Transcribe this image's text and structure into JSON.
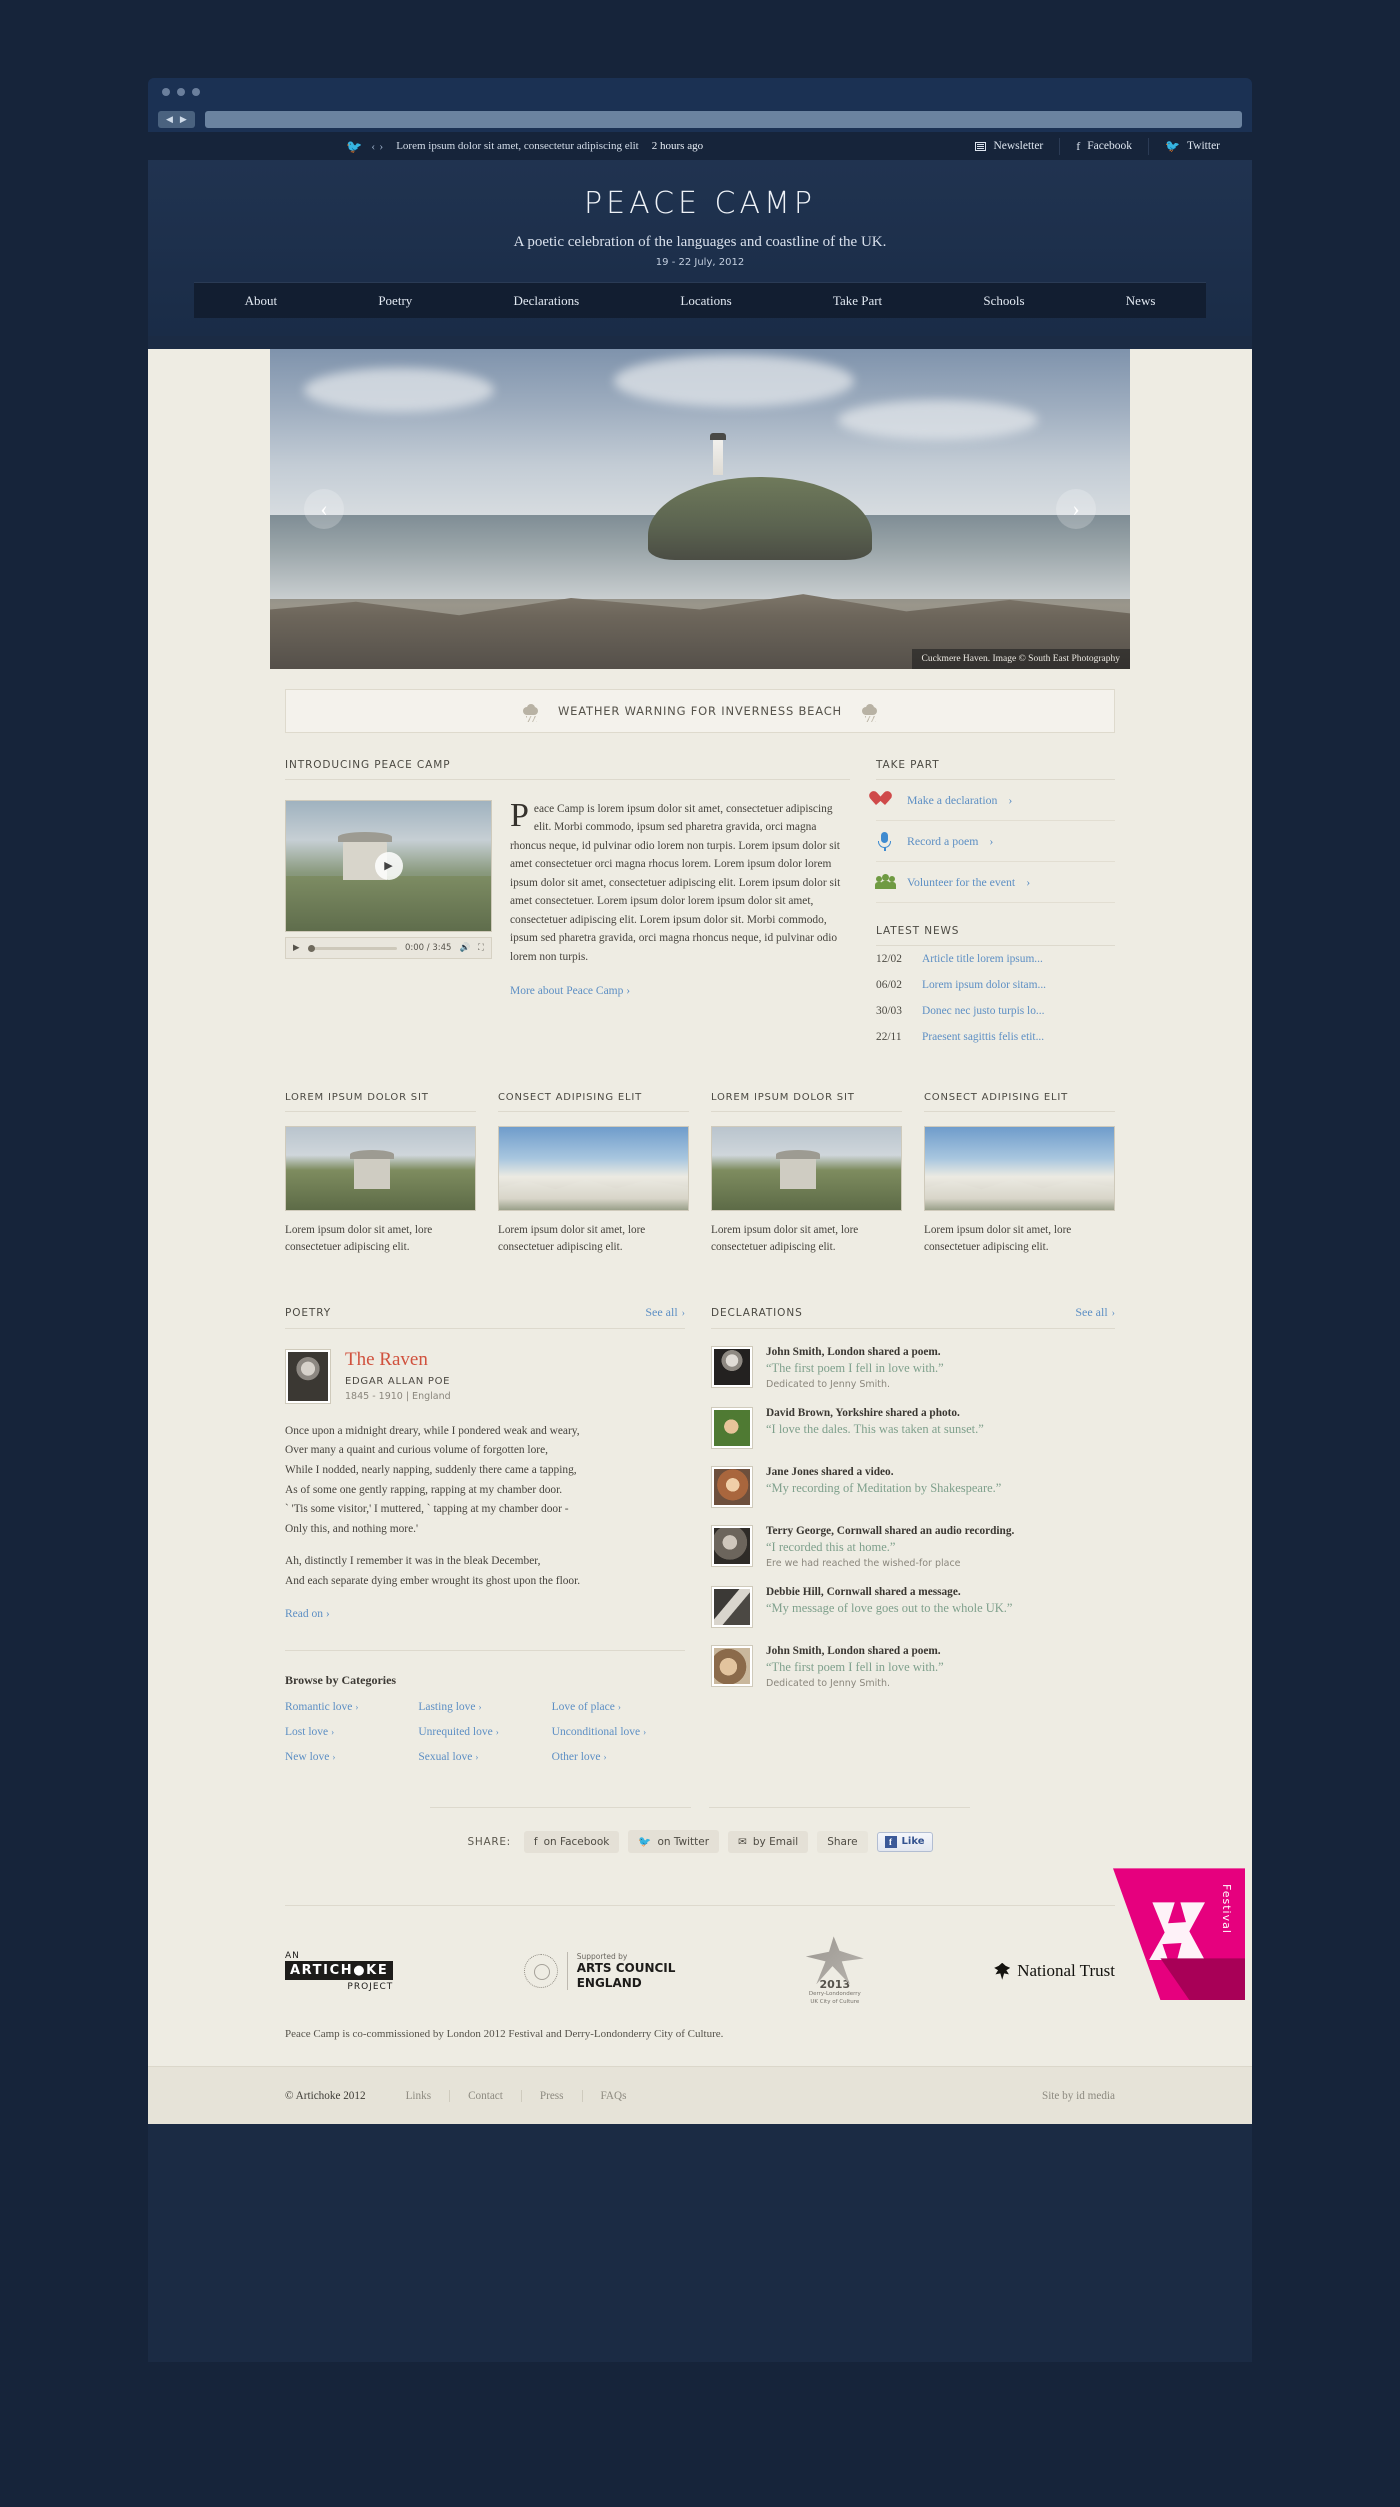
{
  "browser": {
    "nav_back": "◀",
    "nav_forward": "▶"
  },
  "topbar": {
    "tweet_text": "Lorem ipsum dolor sit amet, consectetur adipiscing elit",
    "tweet_time": "2 hours ago",
    "prev": "‹",
    "next": "›",
    "links": [
      {
        "label": "Newsletter",
        "icon": "newsletter-icon"
      },
      {
        "label": "Facebook",
        "icon": "facebook-icon",
        "glyph": "f"
      },
      {
        "label": "Twitter",
        "icon": "twitter-icon",
        "glyph": "🐦"
      }
    ]
  },
  "masthead": {
    "title": "PEACE CAMP",
    "tagline": "A poetic celebration of the languages and coastline of the UK.",
    "dates": "19 - 22 July, 2012"
  },
  "nav": {
    "items": [
      {
        "label": "About"
      },
      {
        "label": "Poetry"
      },
      {
        "label": "Declarations"
      },
      {
        "label": "Locations"
      },
      {
        "label": "Take Part"
      },
      {
        "label": "Schools"
      },
      {
        "label": "News"
      }
    ]
  },
  "hero": {
    "caption": "Cuckmere Haven. Image © South East Photography",
    "prev": "‹",
    "next": "›"
  },
  "weather": {
    "text": "WEATHER WARNING FOR INVERNESS BEACH"
  },
  "intro": {
    "heading": "INTRODUCING PEACE CAMP",
    "body": "Peace Camp is lorem ipsum dolor sit amet, consectetuer adipiscing elit. Morbi commodo, ipsum sed pharetra gravida, orci magna rhoncus neque, id pulvinar odio lorem non turpis. Lorem ipsum dolor sit amet consectetuer orci magna rhocus lorem. Lorem ipsum dolor lorem ipsum dolor sit amet, consectetuer adipiscing elit. Lorem ipsum dolor sit amet consectetuer. Lorem ipsum dolor lorem ipsum dolor sit amet, consectetuer adipiscing elit. Lorem ipsum dolor sit. Morbi commodo, ipsum sed pharetra gravida, orci magna rhoncus neque, id pulvinar odio lorem non turpis.",
    "more_link": "More about Peace Camp",
    "chevron": "›",
    "video": {
      "time": "0:00 / 3:45",
      "play": "▶",
      "volume": "🔊",
      "fullscreen": "⛶",
      "play_overlay": "▶"
    }
  },
  "take_part": {
    "heading": "TAKE PART",
    "items": [
      {
        "label": "Make a declaration",
        "icon": "heart-icon"
      },
      {
        "label": "Record a poem",
        "icon": "microphone-icon"
      },
      {
        "label": "Volunteer for the event",
        "icon": "people-icon"
      }
    ],
    "chevron": "›"
  },
  "latest_news": {
    "heading": "LATEST NEWS",
    "items": [
      {
        "date": "12/02",
        "title": "Article title lorem ipsum..."
      },
      {
        "date": "06/02",
        "title": "Lorem ipsum dolor sitam..."
      },
      {
        "date": "30/03",
        "title": "Donec nec justo turpis lo..."
      },
      {
        "date": "22/11",
        "title": "Praesent sagittis felis etit..."
      }
    ]
  },
  "cards": [
    {
      "heading": "LOREM IPSUM DOLOR SIT",
      "caption": "Lorem ipsum dolor sit amet, lore consectetuer adipiscing elit.",
      "img": "a"
    },
    {
      "heading": "CONSECT ADIPISING ELIT",
      "caption": "Lorem ipsum dolor sit amet, lore consectetuer adipiscing elit.",
      "img": "b"
    },
    {
      "heading": "LOREM IPSUM DOLOR SIT",
      "caption": "Lorem ipsum dolor sit amet, lore consectetuer adipiscing elit.",
      "img": "a"
    },
    {
      "heading": "CONSECT ADIPISING ELIT",
      "caption": "Lorem ipsum dolor sit amet, lore consectetuer adipiscing elit.",
      "img": "b"
    }
  ],
  "poetry": {
    "heading": "POETRY",
    "see_all": "See all",
    "chevron": "›",
    "poem_title": "The Raven",
    "poem_author": "EDGAR ALLAN POE",
    "poem_meta": "1845 - 1910 | England",
    "stanza1": "Once upon a midnight dreary, while I pondered weak and weary,\nOver many a quaint and curious volume of forgotten lore,\nWhile I nodded, nearly napping, suddenly there came a tapping,\nAs of some one gently rapping, rapping at my chamber door.\n` 'Tis some visitor,' I muttered, ` tapping at my chamber door -\nOnly this, and nothing more.'",
    "stanza2": "Ah, distinctly I remember it was in the bleak December,\nAnd each separate dying ember wrought its ghost upon the floor.",
    "read_on": "Read on"
  },
  "categories": {
    "title": "Browse by Categories",
    "chevron": "›",
    "items": [
      "Romantic love",
      "Lasting love",
      "Love of place",
      "Lost love",
      "Unrequited love",
      "Unconditional love",
      "New love",
      "Sexual love",
      "Other love"
    ]
  },
  "declarations": {
    "heading": "DECLARATIONS",
    "see_all": "See all",
    "chevron": "›",
    "items": [
      {
        "name": "John Smith, London shared a poem.",
        "quote": "“The first poem I fell in love with.”",
        "sub": "Dedicated to Jenny Smith.",
        "tone": "bw"
      },
      {
        "name": "David Brown, Yorkshire shared a photo.",
        "quote": "“I love the dales. This was taken at sunset.”",
        "sub": "",
        "tone": "green"
      },
      {
        "name": "Jane Jones shared a video.",
        "quote": "“My recording of Meditation by Shakespeare.”",
        "sub": "",
        "tone": "warm"
      },
      {
        "name": "Terry George, Cornwall shared an audio recording.",
        "quote": "“I recorded this at home.”",
        "sub": "Ere we had reached the wished-for place",
        "tone": "bw"
      },
      {
        "name": "Debbie Hill, Cornwall shared a message.",
        "quote": "“My message of love goes out to the whole UK.”",
        "sub": "",
        "tone": "bw"
      },
      {
        "name": "John Smith, London shared a poem.",
        "quote": "“The first poem I fell in love with.”",
        "sub": "Dedicated to Jenny Smith.",
        "tone": "warm"
      }
    ]
  },
  "share": {
    "label": "SHARE:",
    "buttons": [
      {
        "label": "on Facebook",
        "glyph": "f",
        "icon": "facebook-icon"
      },
      {
        "label": "on Twitter",
        "glyph": "🐦",
        "icon": "twitter-icon"
      },
      {
        "label": "by Email",
        "glyph": "✉",
        "icon": "email-icon"
      },
      {
        "label": "Share",
        "glyph": "",
        "icon": "share-icon"
      }
    ],
    "like_label": "Like",
    "like_glyph": "f"
  },
  "footer_logos": {
    "artichoke": {
      "an": "AN",
      "main": "ARTICH●KE",
      "project": "PROJECT"
    },
    "arts_council": {
      "supported": "Supported by",
      "line1": "ARTS COUNCIL",
      "line2": "ENGLAND",
      "ring": "ARTS COUNCIL ENGLAND"
    },
    "derry": {
      "year": "2013",
      "line1": "Derry-Londonderry",
      "line2": "UK City of Culture"
    },
    "national_trust": {
      "name": "National Trust"
    },
    "festival": {
      "word": "Festival",
      "year": "2012"
    }
  },
  "cocommission": "Peace Camp is co-commissioned by London 2012 Festival and Derry-Londonderry City of Culture.",
  "footer": {
    "copyright": "© Artichoke 2012",
    "links": [
      "Links",
      "Contact",
      "Press",
      "FAQs"
    ],
    "site_by": "Site by id media"
  }
}
